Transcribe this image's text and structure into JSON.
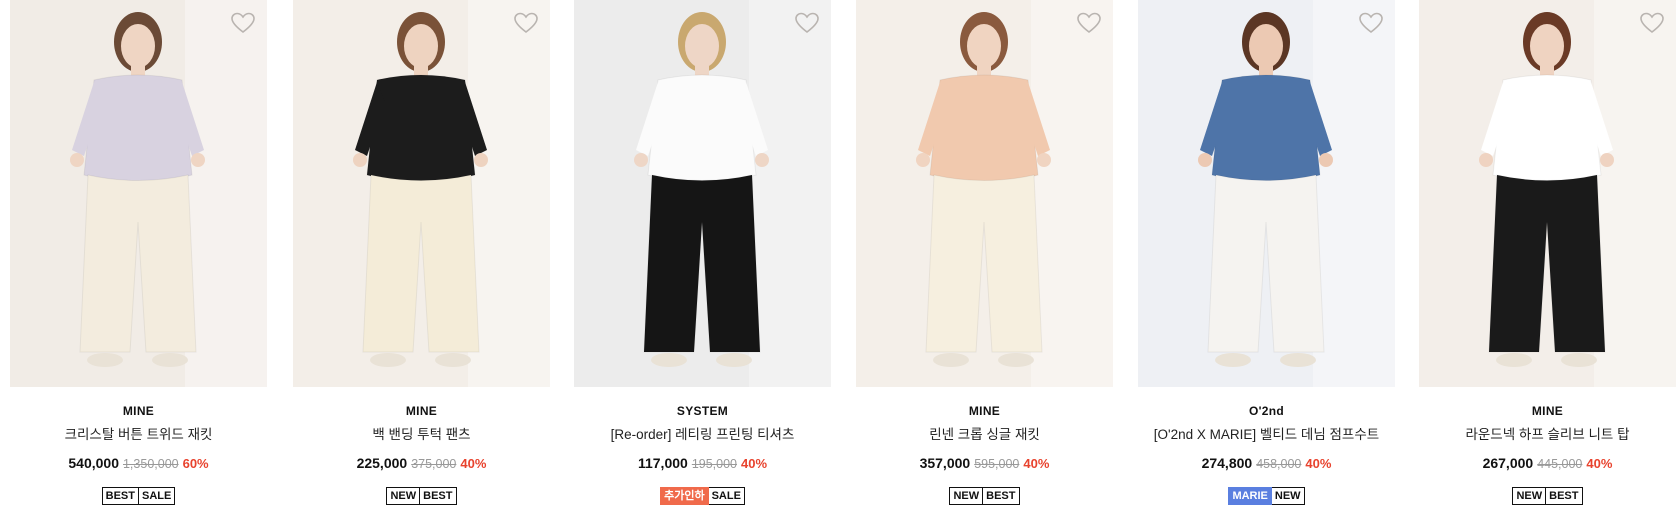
{
  "products": [
    {
      "brand": "MINE",
      "name": "크리스탈 버튼 트위드 재킷",
      "sale_price": "540,000",
      "original_price": "1,350,000",
      "discount": "60%",
      "badges": [
        {
          "label": "BEST",
          "style": "outline"
        },
        {
          "label": "SALE",
          "style": "outline"
        }
      ],
      "colors": {
        "bg": "#f1ece6",
        "top": "#d8d2e0",
        "bottom": "#f3ecde",
        "skin": "#efd5c3",
        "hair": "#6b4a36"
      }
    },
    {
      "brand": "MINE",
      "name": "백 밴딩 투턱 팬츠",
      "sale_price": "225,000",
      "original_price": "375,000",
      "discount": "40%",
      "badges": [
        {
          "label": "NEW",
          "style": "outline"
        },
        {
          "label": "BEST",
          "style": "outline"
        }
      ],
      "colors": {
        "bg": "#f3eee8",
        "top": "#1c1c1c",
        "bottom": "#f4ecd8",
        "skin": "#eed3c0",
        "hair": "#7a5238"
      }
    },
    {
      "brand": "SYSTEM",
      "name": "[Re-order] 레티링 프린팅 티셔츠",
      "sale_price": "117,000",
      "original_price": "195,000",
      "discount": "40%",
      "badges": [
        {
          "label": "추가인하",
          "style": "orange"
        },
        {
          "label": "SALE",
          "style": "outline"
        }
      ],
      "colors": {
        "bg": "#ececec",
        "top": "#fbfbfb",
        "bottom": "#151515",
        "skin": "#eed6c6",
        "hair": "#c9a86f"
      }
    },
    {
      "brand": "MINE",
      "name": "린넨 크롭 싱글 재킷",
      "sale_price": "357,000",
      "original_price": "595,000",
      "discount": "40%",
      "badges": [
        {
          "label": "NEW",
          "style": "outline"
        },
        {
          "label": "BEST",
          "style": "outline"
        }
      ],
      "colors": {
        "bg": "#f4efe9",
        "top": "#f1c9ae",
        "bottom": "#f6efdf",
        "skin": "#f0d4c1",
        "hair": "#8a5a3e"
      }
    },
    {
      "brand": "O'2nd",
      "name": "[O'2nd X MARIE] 벨티드 데님 점프수트",
      "sale_price": "274,800",
      "original_price": "458,000",
      "discount": "40%",
      "badges": [
        {
          "label": "MARIE",
          "style": "blue"
        },
        {
          "label": "NEW",
          "style": "outline"
        }
      ],
      "colors": {
        "bg": "#eef0f4",
        "top": "#4e74a8",
        "bottom": "#f5f3f0",
        "skin": "#ecc9b3",
        "hair": "#5b3624"
      }
    },
    {
      "brand": "MINE",
      "name": "라운드넥 하프 슬리브 니트 탑",
      "sale_price": "267,000",
      "original_price": "445,000",
      "discount": "40%",
      "badges": [
        {
          "label": "NEW",
          "style": "outline"
        },
        {
          "label": "BEST",
          "style": "outline"
        }
      ],
      "colors": {
        "bg": "#f3eee9",
        "top": "#ffffff",
        "bottom": "#1a1a1a",
        "skin": "#efd3c1",
        "hair": "#6a3a26"
      }
    }
  ]
}
